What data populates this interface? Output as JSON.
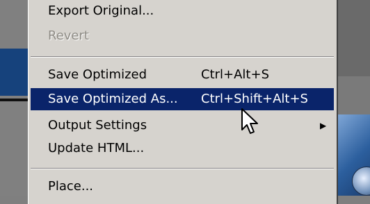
{
  "menu": {
    "items": [
      {
        "label": "Export Original...",
        "shortcut": "",
        "state": "normal"
      },
      {
        "label": "Revert",
        "shortcut": "",
        "state": "disabled"
      },
      {
        "label": "Save Optimized",
        "shortcut": "Ctrl+Alt+S",
        "state": "normal"
      },
      {
        "label": "Save Optimized As...",
        "shortcut": "Ctrl+Shift+Alt+S",
        "state": "highlighted"
      },
      {
        "label": "Output Settings",
        "shortcut": "",
        "state": "normal",
        "submenu_arrow": "▶"
      },
      {
        "label": "Update HTML...",
        "shortcut": "",
        "state": "normal"
      },
      {
        "label": "Place...",
        "shortcut": "",
        "state": "normal"
      }
    ]
  },
  "colors": {
    "menu_bg": "#d6d3ce",
    "highlight_bg": "#0a246a",
    "highlight_text": "#ffffff",
    "disabled_text": "#8e8b85"
  },
  "icons": [
    "submenu-arrow-icon",
    "mouse-pointer-icon"
  ]
}
